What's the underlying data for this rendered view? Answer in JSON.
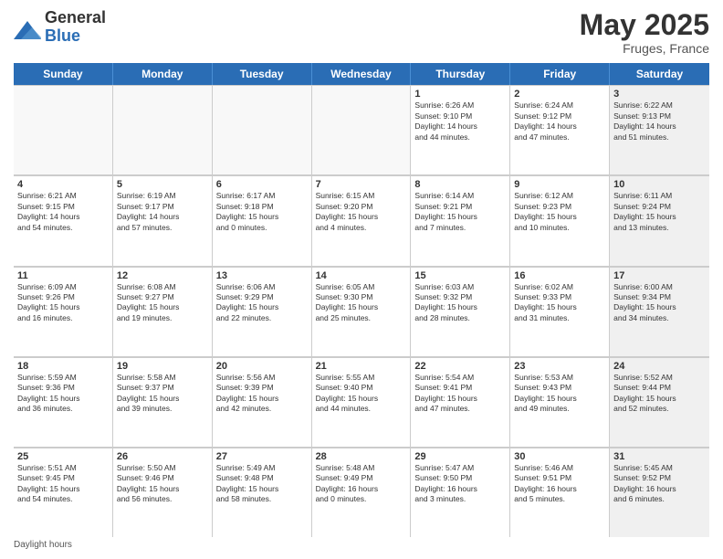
{
  "logo": {
    "general": "General",
    "blue": "Blue"
  },
  "title": "May 2025",
  "location": "Fruges, France",
  "days_header": [
    "Sunday",
    "Monday",
    "Tuesday",
    "Wednesday",
    "Thursday",
    "Friday",
    "Saturday"
  ],
  "weeks": [
    [
      {
        "num": "",
        "info": "",
        "empty": true
      },
      {
        "num": "",
        "info": "",
        "empty": true
      },
      {
        "num": "",
        "info": "",
        "empty": true
      },
      {
        "num": "",
        "info": "",
        "empty": true
      },
      {
        "num": "1",
        "info": "Sunrise: 6:26 AM\nSunset: 9:10 PM\nDaylight: 14 hours\nand 44 minutes."
      },
      {
        "num": "2",
        "info": "Sunrise: 6:24 AM\nSunset: 9:12 PM\nDaylight: 14 hours\nand 47 minutes."
      },
      {
        "num": "3",
        "info": "Sunrise: 6:22 AM\nSunset: 9:13 PM\nDaylight: 14 hours\nand 51 minutes.",
        "shade": true
      }
    ],
    [
      {
        "num": "4",
        "info": "Sunrise: 6:21 AM\nSunset: 9:15 PM\nDaylight: 14 hours\nand 54 minutes."
      },
      {
        "num": "5",
        "info": "Sunrise: 6:19 AM\nSunset: 9:17 PM\nDaylight: 14 hours\nand 57 minutes."
      },
      {
        "num": "6",
        "info": "Sunrise: 6:17 AM\nSunset: 9:18 PM\nDaylight: 15 hours\nand 0 minutes."
      },
      {
        "num": "7",
        "info": "Sunrise: 6:15 AM\nSunset: 9:20 PM\nDaylight: 15 hours\nand 4 minutes."
      },
      {
        "num": "8",
        "info": "Sunrise: 6:14 AM\nSunset: 9:21 PM\nDaylight: 15 hours\nand 7 minutes."
      },
      {
        "num": "9",
        "info": "Sunrise: 6:12 AM\nSunset: 9:23 PM\nDaylight: 15 hours\nand 10 minutes."
      },
      {
        "num": "10",
        "info": "Sunrise: 6:11 AM\nSunset: 9:24 PM\nDaylight: 15 hours\nand 13 minutes.",
        "shade": true
      }
    ],
    [
      {
        "num": "11",
        "info": "Sunrise: 6:09 AM\nSunset: 9:26 PM\nDaylight: 15 hours\nand 16 minutes."
      },
      {
        "num": "12",
        "info": "Sunrise: 6:08 AM\nSunset: 9:27 PM\nDaylight: 15 hours\nand 19 minutes."
      },
      {
        "num": "13",
        "info": "Sunrise: 6:06 AM\nSunset: 9:29 PM\nDaylight: 15 hours\nand 22 minutes."
      },
      {
        "num": "14",
        "info": "Sunrise: 6:05 AM\nSunset: 9:30 PM\nDaylight: 15 hours\nand 25 minutes."
      },
      {
        "num": "15",
        "info": "Sunrise: 6:03 AM\nSunset: 9:32 PM\nDaylight: 15 hours\nand 28 minutes."
      },
      {
        "num": "16",
        "info": "Sunrise: 6:02 AM\nSunset: 9:33 PM\nDaylight: 15 hours\nand 31 minutes."
      },
      {
        "num": "17",
        "info": "Sunrise: 6:00 AM\nSunset: 9:34 PM\nDaylight: 15 hours\nand 34 minutes.",
        "shade": true
      }
    ],
    [
      {
        "num": "18",
        "info": "Sunrise: 5:59 AM\nSunset: 9:36 PM\nDaylight: 15 hours\nand 36 minutes."
      },
      {
        "num": "19",
        "info": "Sunrise: 5:58 AM\nSunset: 9:37 PM\nDaylight: 15 hours\nand 39 minutes."
      },
      {
        "num": "20",
        "info": "Sunrise: 5:56 AM\nSunset: 9:39 PM\nDaylight: 15 hours\nand 42 minutes."
      },
      {
        "num": "21",
        "info": "Sunrise: 5:55 AM\nSunset: 9:40 PM\nDaylight: 15 hours\nand 44 minutes."
      },
      {
        "num": "22",
        "info": "Sunrise: 5:54 AM\nSunset: 9:41 PM\nDaylight: 15 hours\nand 47 minutes."
      },
      {
        "num": "23",
        "info": "Sunrise: 5:53 AM\nSunset: 9:43 PM\nDaylight: 15 hours\nand 49 minutes."
      },
      {
        "num": "24",
        "info": "Sunrise: 5:52 AM\nSunset: 9:44 PM\nDaylight: 15 hours\nand 52 minutes.",
        "shade": true
      }
    ],
    [
      {
        "num": "25",
        "info": "Sunrise: 5:51 AM\nSunset: 9:45 PM\nDaylight: 15 hours\nand 54 minutes."
      },
      {
        "num": "26",
        "info": "Sunrise: 5:50 AM\nSunset: 9:46 PM\nDaylight: 15 hours\nand 56 minutes."
      },
      {
        "num": "27",
        "info": "Sunrise: 5:49 AM\nSunset: 9:48 PM\nDaylight: 15 hours\nand 58 minutes."
      },
      {
        "num": "28",
        "info": "Sunrise: 5:48 AM\nSunset: 9:49 PM\nDaylight: 16 hours\nand 0 minutes."
      },
      {
        "num": "29",
        "info": "Sunrise: 5:47 AM\nSunset: 9:50 PM\nDaylight: 16 hours\nand 3 minutes."
      },
      {
        "num": "30",
        "info": "Sunrise: 5:46 AM\nSunset: 9:51 PM\nDaylight: 16 hours\nand 5 minutes."
      },
      {
        "num": "31",
        "info": "Sunrise: 5:45 AM\nSunset: 9:52 PM\nDaylight: 16 hours\nand 6 minutes.",
        "shade": true
      }
    ]
  ],
  "footer": "Daylight hours"
}
